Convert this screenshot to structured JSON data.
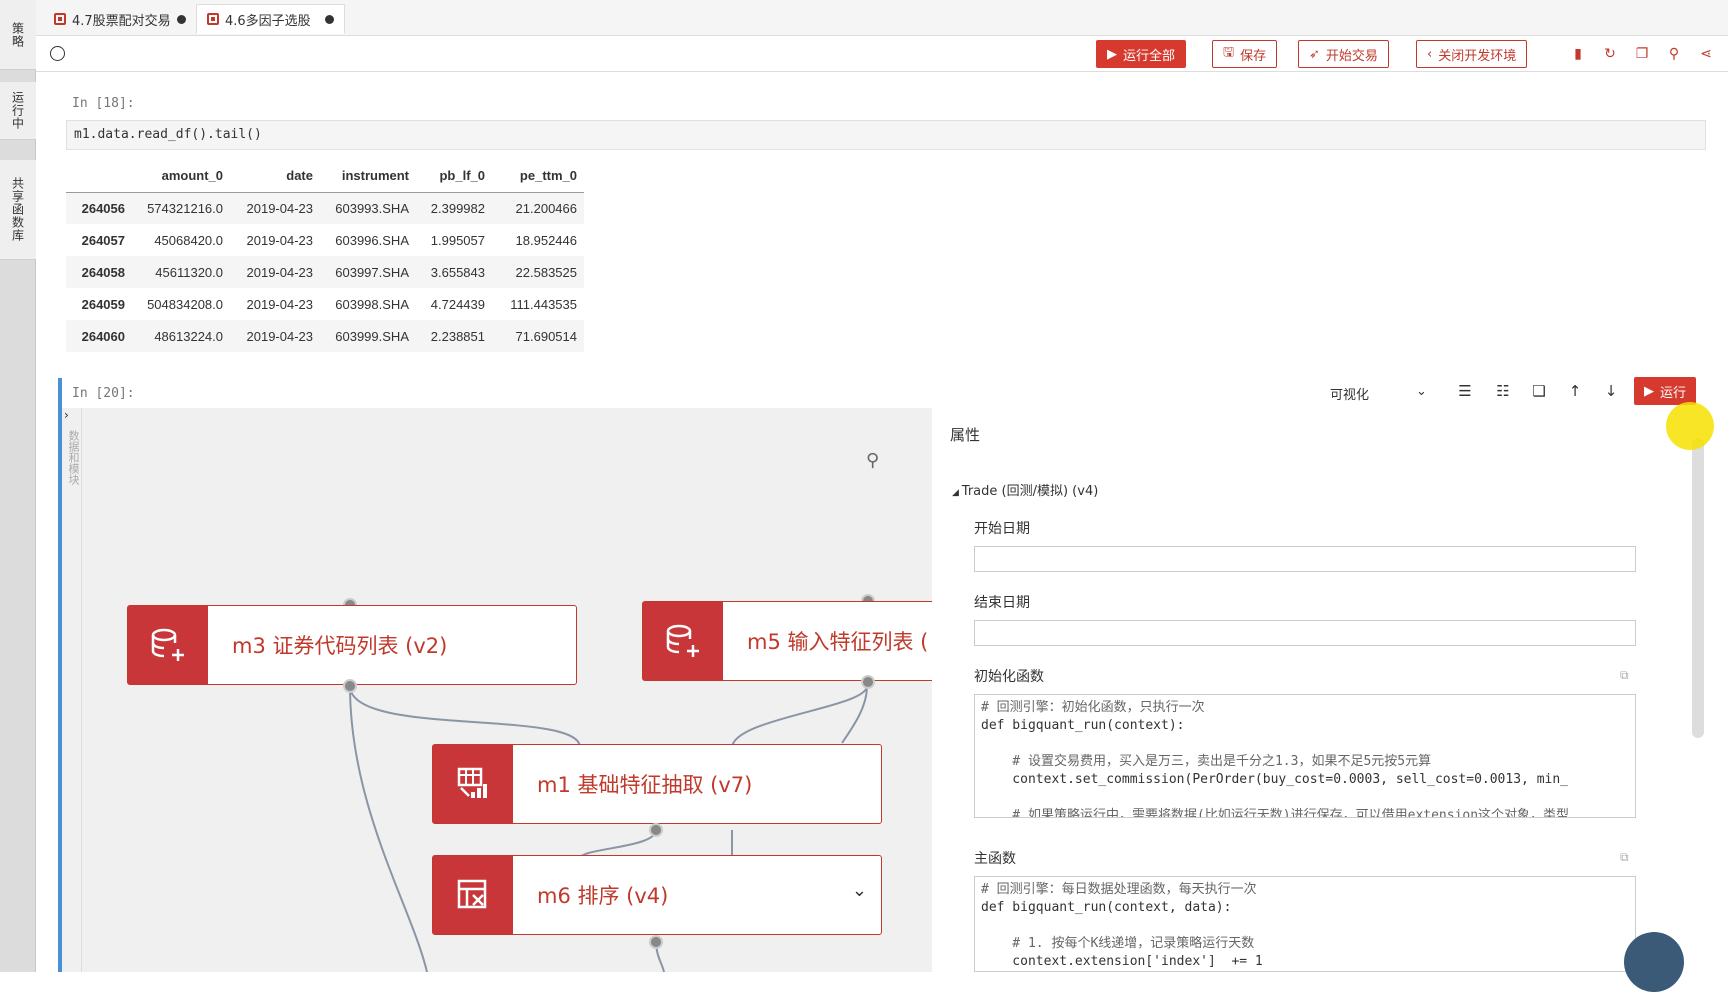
{
  "left_tabs": [
    "策略",
    "运行中",
    "共享函数库"
  ],
  "file_tabs": [
    {
      "label": "4.7股票配对交易"
    },
    {
      "label": "4.6多因子选股"
    }
  ],
  "toolbar": {
    "run_all": "运行全部",
    "save": "保存",
    "start_trade": "开始交易",
    "close_env": "关闭开发环境"
  },
  "cell18": {
    "prompt": "In [18]:",
    "code": "m1.data.read_df().tail()",
    "table": {
      "columns": [
        "",
        "amount_0",
        "date",
        "instrument",
        "pb_lf_0",
        "pe_ttm_0"
      ],
      "rows": [
        [
          "264056",
          "574321216.0",
          "2019-04-23",
          "603993.SHA",
          "2.399982",
          "21.200466"
        ],
        [
          "264057",
          "45068420.0",
          "2019-04-23",
          "603996.SHA",
          "1.995057",
          "18.952446"
        ],
        [
          "264058",
          "45611320.0",
          "2019-04-23",
          "603997.SHA",
          "3.655843",
          "22.583525"
        ],
        [
          "264059",
          "504834208.0",
          "2019-04-23",
          "603998.SHA",
          "4.724439",
          "111.443535"
        ],
        [
          "264060",
          "48613224.0",
          "2019-04-23",
          "603999.SHA",
          "2.238851",
          "71.690514"
        ]
      ]
    }
  },
  "cell20": {
    "prompt": "In [20]:",
    "view_select": "可视化",
    "run": "运行",
    "side_label": "数据和模块",
    "modules": {
      "m3": "m3 证券代码列表 (v2)",
      "m5": "m5 输入特征列表 (",
      "m1": "m1 基础特征抽取 (v7)",
      "m6": "m6 排序 (v4)"
    },
    "props": {
      "title": "属性",
      "section": "Trade (回测/模拟) (v4)",
      "start_date": "开始日期",
      "end_date": "结束日期",
      "init_func": "初始化函数",
      "init_code": [
        "# 回测引擎：初始化函数，只执行一次",
        "def bigquant_run(context):",
        "",
        "    # 设置交易费用，买入是万三，卖出是千分之1.3，如果不足5元按5元算",
        "    context.set_commission(PerOrder(buy_cost=0.0003, sell_cost=0.0013, min_",
        "",
        "    # 如果策略运行中，需要将数据(比如运行天数)进行保存，可以借用extension这个对象，类型"
      ],
      "main_func": "主函数",
      "main_code": [
        "# 回测引擎：每日数据处理函数，每天执行一次",
        "def bigquant_run(context, data):",
        "",
        "    # 1. 按每个K线递增，记录策略运行天数",
        "    context.extension['index']  += 1"
      ]
    }
  }
}
